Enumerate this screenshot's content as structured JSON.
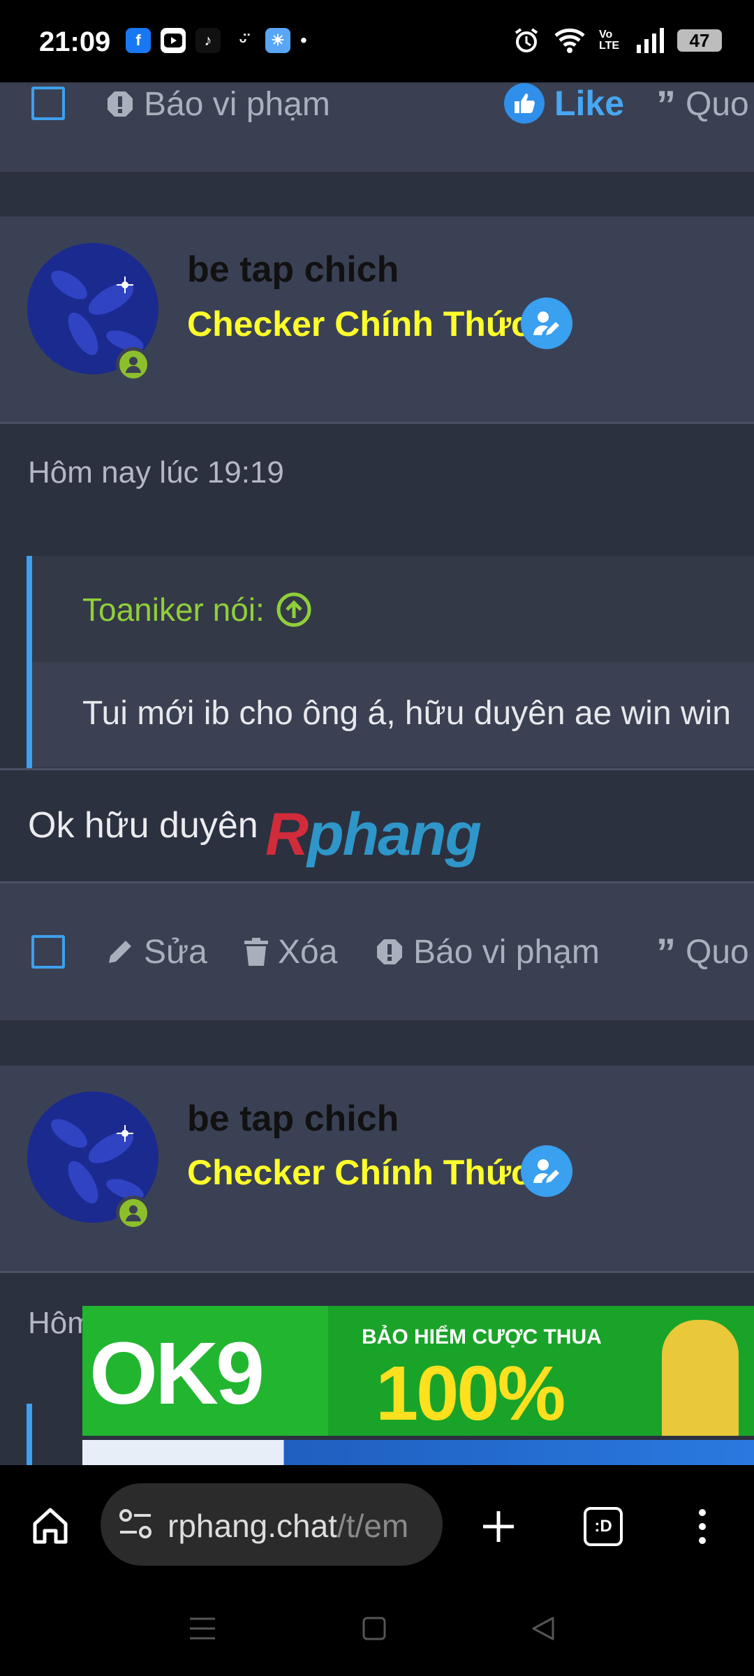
{
  "status_bar": {
    "time": "21:09",
    "apps": [
      "facebook-icon",
      "youtube-icon",
      "tiktok-icon",
      "messenger-icon",
      "weather-icon"
    ],
    "dot": "•",
    "right_icons": [
      "alarm-icon",
      "wifi-icon",
      "volte-icon",
      "signal-icon"
    ],
    "volte": "Vo LTE",
    "battery": "47"
  },
  "top_bar": {
    "report": "Báo vi phạm",
    "like": "Like",
    "quote": "Quo"
  },
  "posts": [
    {
      "username": "be tap chich",
      "role": "Checker Chính Thức",
      "time": "Hôm nay lúc 19:19",
      "quote_author": "Toaniker nói:",
      "quote_text": "Tui mới ib cho ông á, hữu duyên ae win win",
      "message": "Ok hữu duyên",
      "watermark_a": "R",
      "watermark_b": "phang",
      "actions": {
        "edit": "Sửa",
        "delete": "Xóa",
        "report": "Báo vi phạm",
        "quote": "Quo"
      }
    },
    {
      "username": "be tap chich",
      "role": "Checker Chính Thức",
      "time_partial": "Hôm"
    }
  ],
  "ad": {
    "logo": "OK9",
    "headline": "BẢO HIỂM CƯỢC THUA",
    "percent": "100%"
  },
  "browser": {
    "url_main": "rphang.chat",
    "url_path": "/t/em",
    "tabs_icon": ":D"
  },
  "colors": {
    "accent_blue": "#3ea0ef",
    "role_yellow": "#ffff2b",
    "quote_green": "#8fcf3a",
    "background": "#2c3140"
  }
}
